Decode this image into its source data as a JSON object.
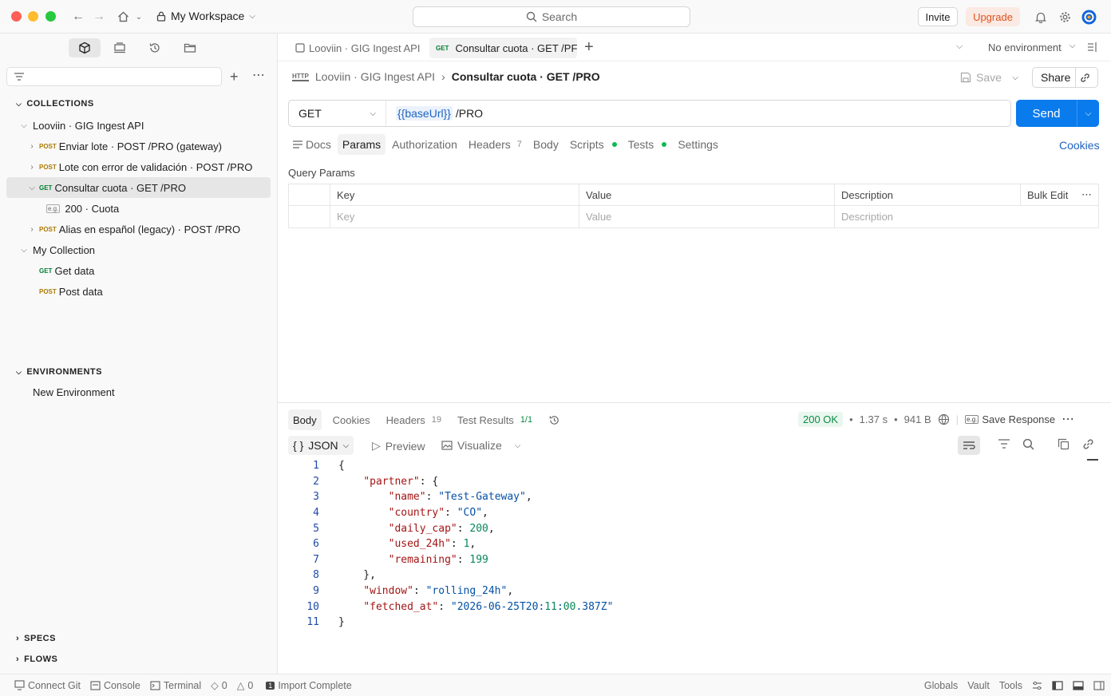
{
  "titlebar": {
    "workspace": "My Workspace",
    "search_placeholder": "Search",
    "invite": "Invite",
    "upgrade": "Upgrade"
  },
  "sidebar": {
    "collections_header": "COLLECTIONS",
    "tree": [
      {
        "label": "Looviin · GIG Ingest API"
      },
      {
        "method": "POST",
        "label": "Enviar lote · POST /PRO (gateway)"
      },
      {
        "method": "POST",
        "label": "Lote con error de validación · POST /PRO"
      },
      {
        "method": "GET",
        "label": "Consultar cuota · GET /PRO"
      },
      {
        "label": "200 · Cuota",
        "badge": "e.g."
      },
      {
        "method": "POST",
        "label": "Alias en español (legacy) · POST /PRO"
      },
      {
        "label": "My Collection"
      },
      {
        "method": "GET",
        "label": "Get data"
      },
      {
        "method": "POST",
        "label": "Post data"
      }
    ],
    "environments_header": "ENVIRONMENTS",
    "env_item": "New Environment",
    "specs": "SPECS",
    "flows": "FLOWS"
  },
  "tabs": {
    "tab1": "Looviin · GIG Ingest API",
    "tab2_method": "GET",
    "tab2": "Consultar cuota · GET /PF",
    "environment": "No environment"
  },
  "breadcrumb": {
    "parent": "Looviin · GIG Ingest API",
    "current": "Consultar cuota · GET /PRO",
    "save": "Save",
    "share": "Share"
  },
  "request": {
    "method": "GET",
    "var": "{{baseUrl}}",
    "path": " /PRO",
    "send": "Send",
    "tabs": [
      "Docs",
      "Params",
      "Authorization",
      "Headers",
      "Body",
      "Scripts",
      "Tests",
      "Settings"
    ],
    "headers_count": "7",
    "cookies": "Cookies"
  },
  "query": {
    "title": "Query Params",
    "cols": [
      "Key",
      "Value",
      "Description"
    ],
    "bulk_edit": "Bulk Edit",
    "placeholders": [
      "Key",
      "Value",
      "Description"
    ]
  },
  "response": {
    "tabs": [
      "Body",
      "Cookies",
      "Headers",
      "Test Results"
    ],
    "headers_count": "19",
    "tests_count": "1/1",
    "status": "200 OK",
    "time": "1.37 s",
    "size": "941 B",
    "save_response": "Save Response",
    "format": "JSON",
    "preview": "Preview",
    "visualize": "Visualize"
  },
  "code": [
    "{",
    "    \"partner\": {",
    "        \"name\": \"Test-Gateway\",",
    "        \"country\": \"CO\",",
    "        \"daily_cap\": 200,",
    "        \"used_24h\": 1,",
    "        \"remaining\": 199",
    "    },",
    "    \"window\": \"rolling_24h\",",
    "    \"fetched_at\": \"2026-06-25T20:11:00.387Z\"",
    "}"
  ],
  "statusbar": {
    "connect_git": "Connect Git",
    "console": "Console",
    "terminal": "Terminal",
    "errors": "0",
    "warnings": "0",
    "import": "Import Complete",
    "globals": "Globals",
    "vault": "Vault",
    "tools": "Tools"
  },
  "colors": {
    "send": "#097bed",
    "upgrade": "#e0531f",
    "status_ok": "#0e8a44"
  }
}
